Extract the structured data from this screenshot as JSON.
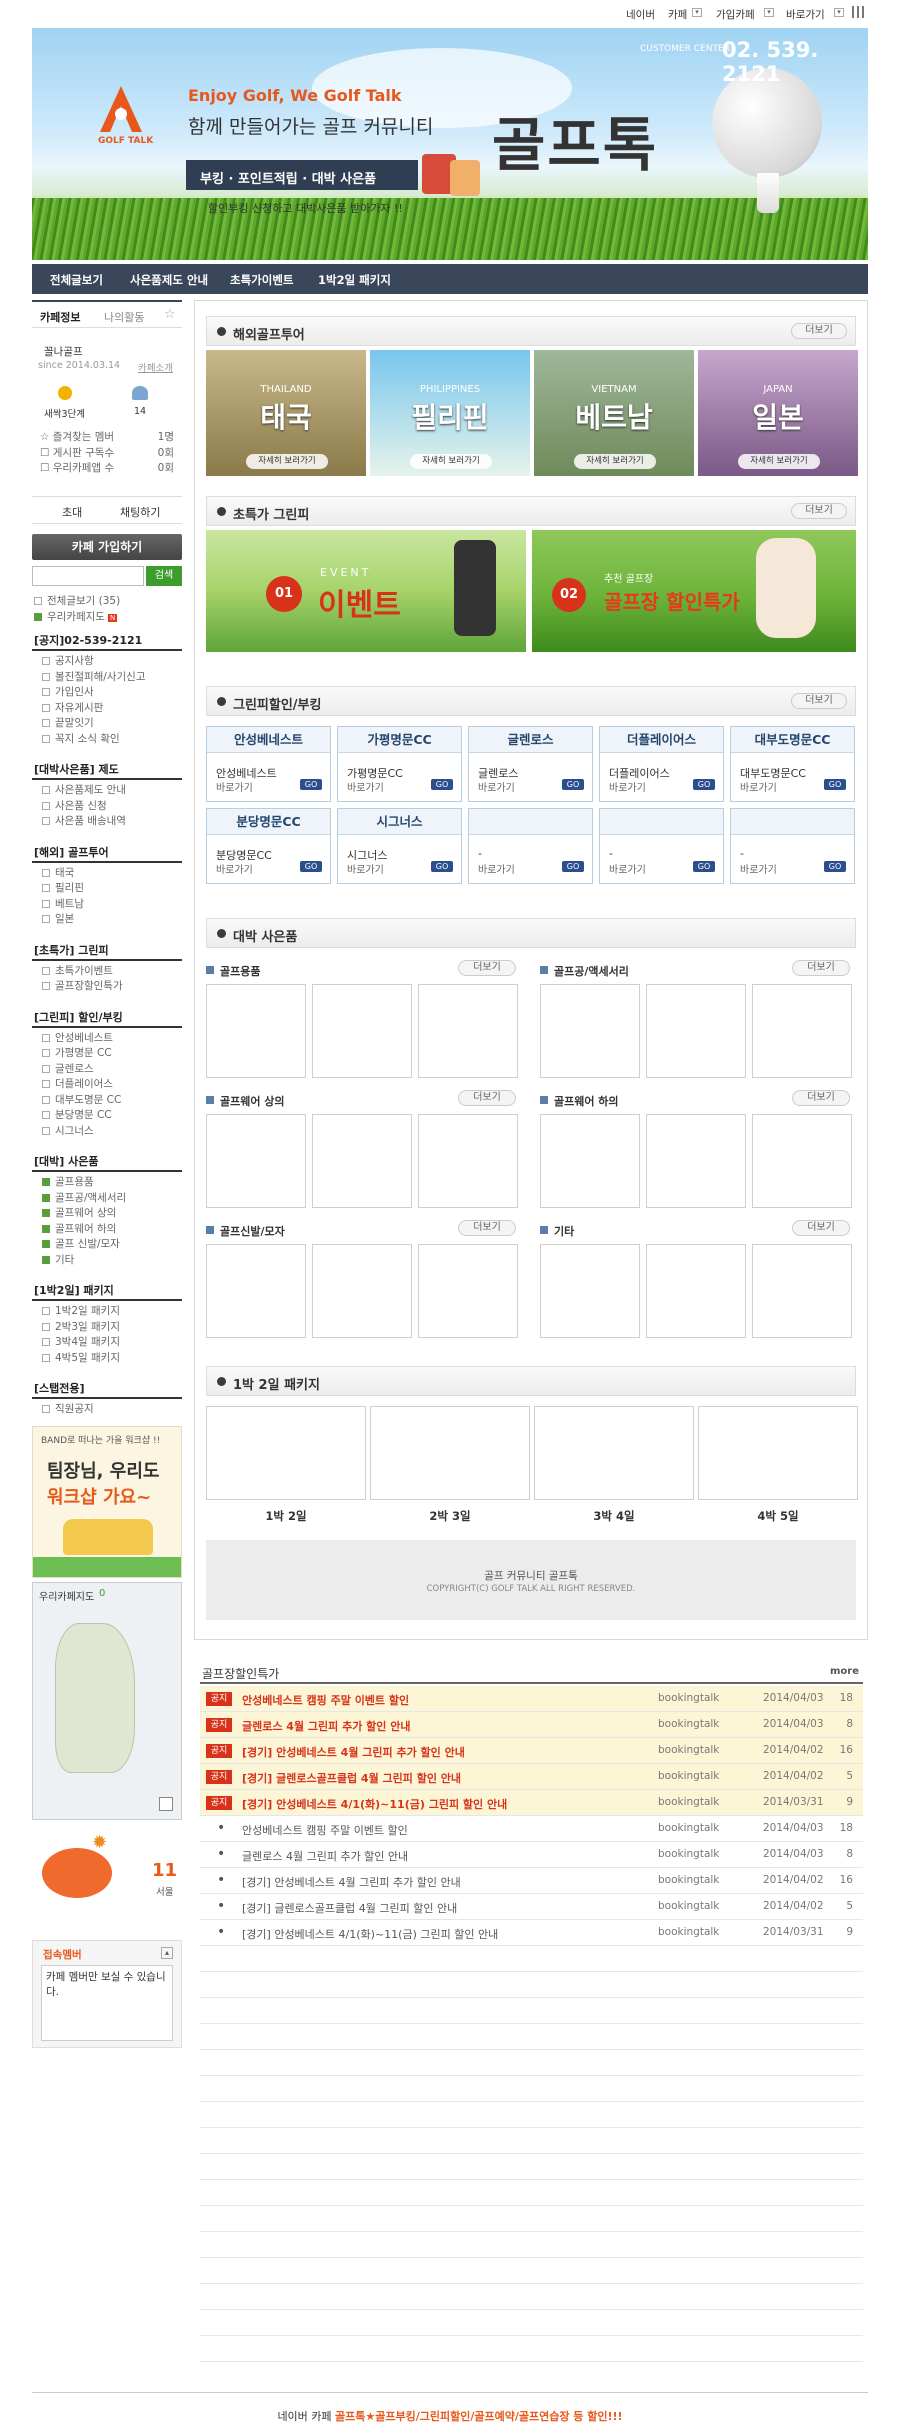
{
  "topbar": {
    "naver": "네이버",
    "cafe": "카페",
    "joined": "가입카페",
    "shortcut": "바로가기"
  },
  "header": {
    "customer_label": "CUSTOMER CENTER",
    "phone": "02. 539. 2121",
    "logo_text": "GOLF TALK",
    "enjoy": "Enjoy Golf, We Golf Talk",
    "sub": "함께 만들어가는 골프 커뮤니티",
    "brand": "골프톡",
    "ribbon": "부킹 · 포인트적립 · 대박 사은품",
    "note": "할인부킹 신청하고 대박사은품 받아가자 !!"
  },
  "nav": [
    "전체글보기",
    "사은품제도 안내",
    "초특가이벤트",
    "1박2일 패키지"
  ],
  "sidebar": {
    "tab_info": "카페정보",
    "tab_activity": "나의활동",
    "manager": "꼴나골프",
    "since": "since 2014.03.14",
    "intro": "카페소개",
    "rank": "새싹3단계",
    "members": "14",
    "stats": [
      {
        "label": "즐겨찾는 멤버",
        "val": "1명"
      },
      {
        "label": "게시판 구독수",
        "val": "0회"
      },
      {
        "label": "우리카페앱 수",
        "val": "0회"
      }
    ],
    "invite": "초대",
    "chat": "채팅하기",
    "join": "카페 가입하기",
    "search_btn": "검색",
    "all_posts": "전체글보기 (35)",
    "map_link": "우리카페지도",
    "groups": [
      {
        "title": "[공지]02-539-2121",
        "items": [
          "공지사항",
          "볼진절피해/사기신고",
          "가입인사",
          "자유게시판",
          "끝말잇기",
          "꼭지 소식 확인"
        ]
      },
      {
        "title": "[대박사은품] 제도",
        "items": [
          "사은품제도 안내",
          "사은품 신청",
          "사은품 배송내역"
        ]
      },
      {
        "title": "[해외] 골프투어",
        "items": [
          "태국",
          "필리핀",
          "베트남",
          "일본"
        ]
      },
      {
        "title": "[초특가] 그린피",
        "items": [
          "초특가이벤트",
          "골프장할인특가"
        ]
      },
      {
        "title": "[그린피] 할인/부킹",
        "items": [
          "안성베네스트",
          "가평명문 CC",
          "글렌로스",
          "더플레이어스",
          "대부도명문 CC",
          "분당명문 CC",
          "시그너스"
        ]
      },
      {
        "title": "[대박] 사은품",
        "items": [
          "골프용품",
          "골프공/액세서리",
          "골프웨어 상의",
          "골프웨어 하의",
          "골프 신발/모자",
          "기타"
        ]
      },
      {
        "title": "[1박2일] 패키지",
        "items": [
          "1박2일 패키지",
          "2박3일 패키지",
          "3박4일 패키지",
          "4박5일 패키지"
        ]
      },
      {
        "title": "[스탭전용]",
        "items": [
          "직원공지"
        ]
      }
    ],
    "band_banner": {
      "line1": "BAND로 떠나는 가을 워크샵 !!",
      "line2": "팀장님, 우리도",
      "line3": "워크샵 가요~"
    },
    "map_title": "우리카페지도",
    "map_count": "0",
    "weather_num": "11",
    "weather_city": "서울",
    "member_box_title": "접속멤버",
    "member_box_text": "카페 멤버만 보실 수 있습니다."
  },
  "tour": {
    "title": "해외골프투어",
    "more": "더보기",
    "items": [
      {
        "en": "THAILAND",
        "ko": "태국",
        "btn": "자세히 보러가기"
      },
      {
        "en": "PHILIPPINES",
        "ko": "필리핀",
        "btn": "자세히 보러가기"
      },
      {
        "en": "VIETNAM",
        "ko": "베트남",
        "btn": "자세히 보러가기"
      },
      {
        "en": "JAPAN",
        "ko": "일본",
        "btn": "자세히 보러가기"
      }
    ]
  },
  "special": {
    "title": "초특가 그린피",
    "more": "더보기",
    "b1_num": "01",
    "b1_small": "EVENT",
    "b1_text": "이벤트",
    "b2_num": "02",
    "b2_small": "추천 골프장",
    "b2_text": "골프장 할인특가"
  },
  "greenfee": {
    "title": "그린피할인/부킹",
    "more": "더보기",
    "book": "바로가기",
    "go": "GO",
    "items": [
      {
        "n": "안성베네스트",
        "s": "안성베네스트"
      },
      {
        "n": "가평명문CC",
        "s": "가평명문CC"
      },
      {
        "n": "글렌로스",
        "s": "글렌로스"
      },
      {
        "n": "더플레이어스",
        "s": "더플레이어스"
      },
      {
        "n": "대부도명문CC",
        "s": "대부도명문CC"
      },
      {
        "n": "분당명문CC",
        "s": "분당명문CC"
      },
      {
        "n": "시그너스",
        "s": "시그너스"
      },
      {
        "n": "",
        "s": "-"
      },
      {
        "n": "",
        "s": "-"
      },
      {
        "n": "",
        "s": "-"
      }
    ]
  },
  "gifts": {
    "title": "대박 사은품",
    "more": "더보기",
    "cats": [
      "골프용품",
      "골프공/액세서리",
      "골프웨어 상의",
      "골프웨어 하의",
      "골프신발/모자",
      "기타"
    ]
  },
  "package": {
    "title": "1박 2일 패키지",
    "items": [
      "1박 2일",
      "2박 3일",
      "3박 4일",
      "4박 5일"
    ]
  },
  "footer_box": {
    "line1": "골프 커뮤니티 골프톡",
    "line2": "COPYRIGHT(C) GOLF TALK ALL RIGHT RESERVED."
  },
  "board": {
    "title": "골프장할인특가",
    "more": "more",
    "notice_tag": "공지",
    "notices": [
      {
        "t": "안성베네스트 캠핑 주말 이벤트 할인",
        "a": "bookingtalk",
        "d": "2014/04/03",
        "c": "18"
      },
      {
        "t": "글렌로스 4월 그린피 추가 할인 안내",
        "a": "bookingtalk",
        "d": "2014/04/03",
        "c": "8"
      },
      {
        "t": "[경기] 안성베네스트 4월 그린피 추가 할인 안내",
        "a": "bookingtalk",
        "d": "2014/04/02",
        "c": "16"
      },
      {
        "t": "[경기] 글렌로스골프클럽 4월 그린피 할인 안내",
        "a": "bookingtalk",
        "d": "2014/04/02",
        "c": "5"
      },
      {
        "t": "[경기] 안성베네스트 4/1(화)~11(금) 그린피 할인 안내",
        "a": "bookingtalk",
        "d": "2014/03/31",
        "c": "9"
      }
    ],
    "posts": [
      {
        "t": "안성베네스트 캠핑 주말 이벤트 할인",
        "a": "bookingtalk",
        "d": "2014/04/03",
        "c": "18"
      },
      {
        "t": "글렌로스 4월 그린피 추가 할인 안내",
        "a": "bookingtalk",
        "d": "2014/04/03",
        "c": "8"
      },
      {
        "t": "[경기] 안성베네스트 4월 그린피 추가 할인 안내",
        "a": "bookingtalk",
        "d": "2014/04/02",
        "c": "16"
      },
      {
        "t": "[경기] 글렌로스골프클럽 4월 그린피 할인 안내",
        "a": "bookingtalk",
        "d": "2014/04/02",
        "c": "5"
      },
      {
        "t": "[경기] 안성베네스트 4/1(화)~11(금) 그린피 할인 안내",
        "a": "bookingtalk",
        "d": "2014/03/31",
        "c": "9"
      }
    ]
  },
  "bottom": {
    "prefix": "네이버 카페",
    "link": "골프톡★골프부킹/그린피할인/골프예약/골프연습장 등 할인!!!"
  },
  "colors": {
    "nav": "#3a475a",
    "accent": "#e8581b",
    "phone": "#ffffff",
    "notice": "#d8321a",
    "greenfee_title": "#25476e"
  }
}
